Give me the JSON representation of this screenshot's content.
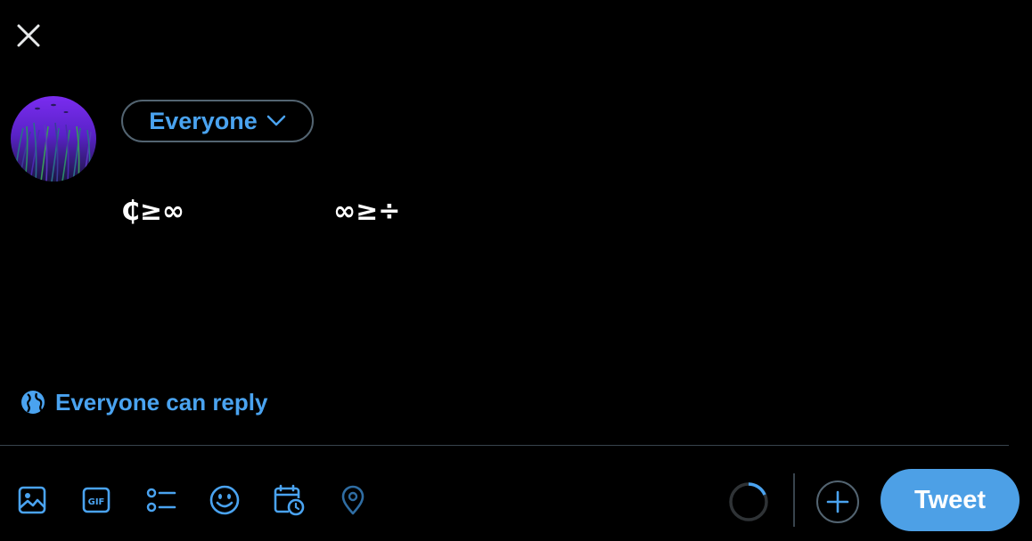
{
  "header": {
    "close_icon": "close-icon"
  },
  "composer": {
    "audience_label": "Everyone",
    "audience_icon": "chevron-down-icon",
    "text": "₵≥∞                ∞≥÷"
  },
  "reply_setting": {
    "label": "Everyone can reply",
    "icon": "globe-icon"
  },
  "toolbar": {
    "icons": [
      "image-icon",
      "gif-icon",
      "poll-icon",
      "emoji-icon",
      "schedule-icon",
      "location-icon"
    ],
    "add_thread_icon": "plus-icon",
    "tweet_label": "Tweet"
  },
  "colors": {
    "background": "#000000",
    "accent": "#4aa3f0",
    "tweet_button": "#4da0e6",
    "border": "#536471",
    "divider": "#38444d"
  }
}
